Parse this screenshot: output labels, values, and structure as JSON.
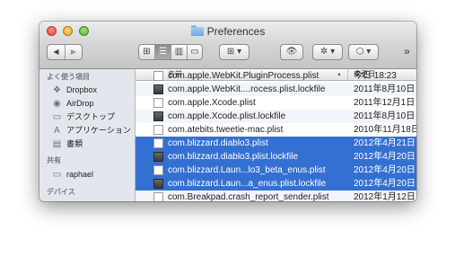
{
  "window": {
    "title": "Preferences"
  },
  "toolbar": {
    "back": "◀",
    "forward": "▶",
    "view_icon": "⊞",
    "view_list": "☰",
    "view_column": "▥",
    "view_coverflow": "▭",
    "arrange": "⊞ ▾",
    "quicklook": "👁",
    "action": "✲ ▾",
    "dropbox": "⬡ ▾",
    "more": "»"
  },
  "sidebar": {
    "favorites_heading": "よく使う項目",
    "favorites": [
      {
        "label": "Dropbox",
        "icon": "dropbox-icon",
        "glyph": "❖"
      },
      {
        "label": "AirDrop",
        "icon": "airdrop-icon",
        "glyph": "◉"
      },
      {
        "label": "デスクトップ",
        "icon": "desktop-icon",
        "glyph": "▭"
      },
      {
        "label": "アプリケーション",
        "icon": "applications-icon",
        "glyph": "A"
      },
      {
        "label": "書類",
        "icon": "documents-icon",
        "glyph": "▤"
      }
    ],
    "shared_heading": "共有",
    "shared": [
      {
        "label": "raphael",
        "icon": "computer-icon",
        "glyph": "▭"
      }
    ],
    "devices_heading": "デバイス"
  },
  "list": {
    "columns": {
      "name": "名前",
      "date": "変更日"
    },
    "rows": [
      {
        "name": "com.apple.WebKit.PluginProcess.plist",
        "date": "今日 18:23",
        "type": "plist",
        "selected": false
      },
      {
        "name": "com.apple.WebKit....rocess.plist.lockfile",
        "date": "2011年8月10日",
        "type": "lock",
        "selected": false
      },
      {
        "name": "com.apple.Xcode.plist",
        "date": "2011年12月1日",
        "type": "plist",
        "selected": false
      },
      {
        "name": "com.apple.Xcode.plist.lockfile",
        "date": "2011年8月10日",
        "type": "lock",
        "selected": false
      },
      {
        "name": "com.atebits.tweetie-mac.plist",
        "date": "2010年11月18日",
        "type": "plist",
        "selected": false
      },
      {
        "name": "com.blizzard.diablo3.plist",
        "date": "2012年4月21日",
        "type": "plist",
        "selected": true
      },
      {
        "name": "com.blizzard.diablo3.plist.lockfile",
        "date": "2012年4月20日",
        "type": "lock",
        "selected": true
      },
      {
        "name": "com.blizzard.Laun...lo3_beta_enus.plist",
        "date": "2012年4月20日",
        "type": "plist",
        "selected": true
      },
      {
        "name": "com.blizzard.Laun...a_enus.plist.lockfile",
        "date": "2012年4月20日",
        "type": "lock",
        "selected": true
      },
      {
        "name": "com.Breakpad.crash_report_sender.plist",
        "date": "2012年1月12日",
        "type": "plist",
        "selected": false
      }
    ]
  },
  "colors": {
    "selection": "#3470d1",
    "sidebar_bg": "#e3e7ed"
  }
}
